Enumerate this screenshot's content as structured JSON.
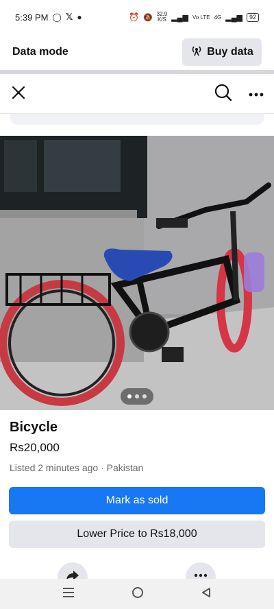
{
  "status_bar": {
    "time": "5:39 PM",
    "speed": "32.9",
    "speed_unit": "K/S",
    "network_a": "Vo LTE",
    "network_b": "4G",
    "battery": "92"
  },
  "data_bar": {
    "title": "Data mode",
    "buy_label": "Buy data"
  },
  "header": {
    "close_icon": "close-icon",
    "search_icon": "search-icon",
    "more_icon": "more-icon"
  },
  "photo": {
    "subject": "bicycle-photo",
    "carousel_count": 3,
    "carousel_active": 1
  },
  "listing": {
    "title": "Bicycle",
    "price": "Rs20,000",
    "meta": "Listed 2 minutes ago · Pakistan"
  },
  "actions": {
    "primary_label": "Mark as sold",
    "secondary_label": "Lower Price to Rs18,000"
  },
  "colors": {
    "accent": "#1877f2",
    "secondary_bg": "#e4e6eb"
  }
}
